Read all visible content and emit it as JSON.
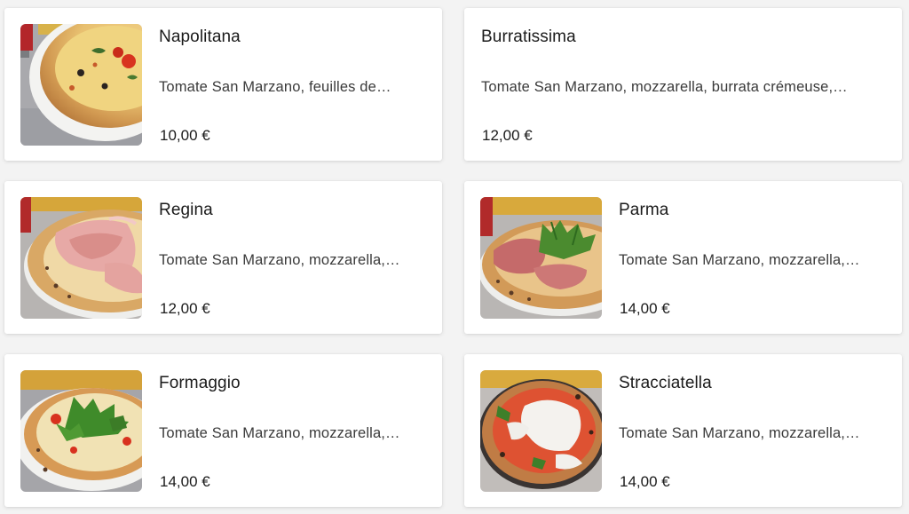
{
  "menu": {
    "items": [
      {
        "name": "Napolitana",
        "description": "Tomate San Marzano, feuilles de…",
        "price": "10,00 €",
        "has_image": true,
        "image": "pizza-napolitana-photo"
      },
      {
        "name": "Burratissima",
        "description": "Tomate San Marzano, mozzarella, burrata crémeuse,…",
        "price": "12,00 €",
        "has_image": false
      },
      {
        "name": "Regina",
        "description": "Tomate San Marzano, mozzarella,…",
        "price": "12,00 €",
        "has_image": true,
        "image": "pizza-regina-photo"
      },
      {
        "name": "Parma",
        "description": "Tomate San Marzano, mozzarella,…",
        "price": "14,00 €",
        "has_image": true,
        "image": "pizza-parma-photo"
      },
      {
        "name": "Formaggio",
        "description": "Tomate San Marzano, mozzarella,…",
        "price": "14,00 €",
        "has_image": true,
        "image": "pizza-formaggio-photo"
      },
      {
        "name": "Stracciatella",
        "description": "Tomate San Marzano, mozzarella,…",
        "price": "14,00 €",
        "has_image": true,
        "image": "pizza-stracciatella-photo"
      }
    ]
  },
  "colors": {
    "background": "#f3f3f3",
    "card": "#ffffff",
    "text_primary": "#1b1b1b",
    "text_secondary": "#3a3a3a"
  }
}
